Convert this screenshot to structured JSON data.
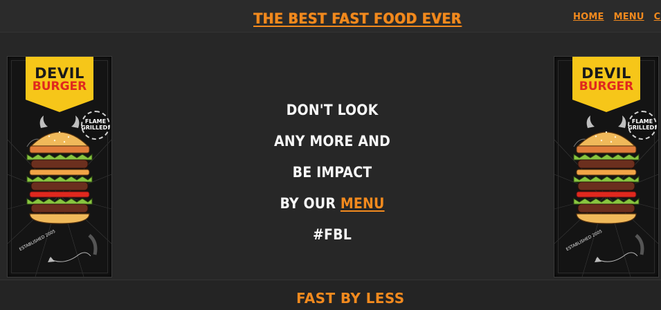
{
  "header": {
    "title": "THE BEST FAST FOOD EVER",
    "nav": [
      "HOME",
      "MENU",
      "CONTAC"
    ]
  },
  "poster": {
    "brand_line1": "DEVIL",
    "brand_line2": "BURGER",
    "badge": "FLAME GRILLED!",
    "established": "ESTABLISHED 2005"
  },
  "main": {
    "lines": [
      "DON'T LOOK",
      "ANY MORE AND",
      "BE IMPACT",
      "BY OUR"
    ],
    "menu_link": "MENU",
    "hashtag": "#FBL"
  },
  "footer": {
    "text": "FAST BY LESS"
  },
  "colors": {
    "accent": "#f28a1e",
    "background": "#272727",
    "text": "#f7f7f7",
    "banner_yellow": "#f6c619",
    "banner_red": "#e0281e"
  }
}
